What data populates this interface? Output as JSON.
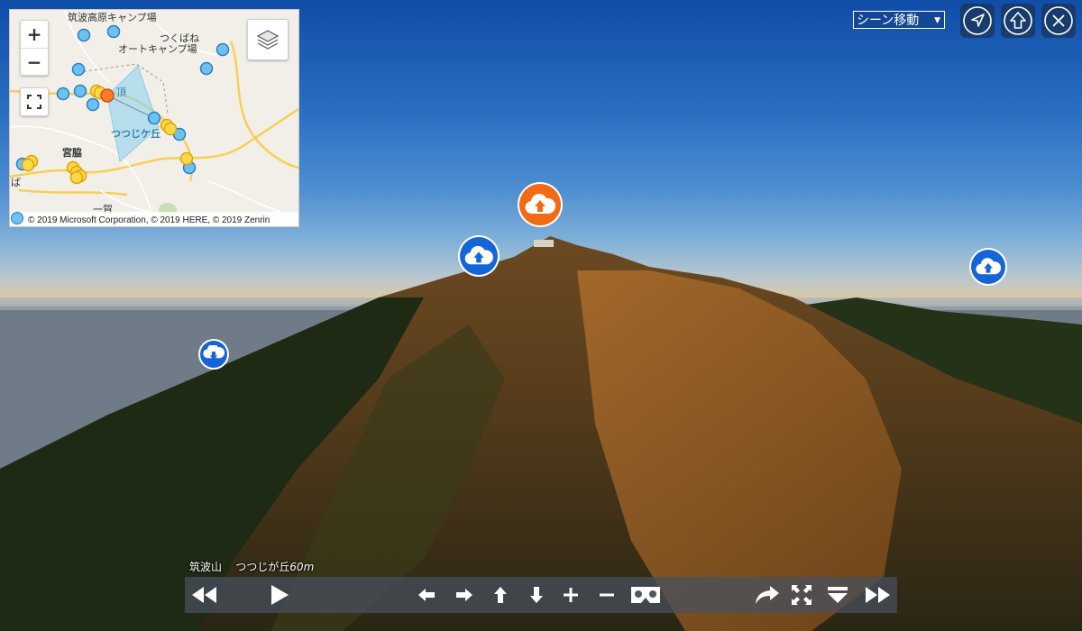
{
  "map": {
    "zoom_in": "+",
    "zoom_out": "−",
    "labels": {
      "camp1": "筑波高原キャンプ場",
      "camp2a": "つくばね",
      "camp2b": "オートキャンプ場",
      "summit": "頂",
      "tsutsuji": "つつじケ丘",
      "miyawaki": "宮脇",
      "edge": "ば",
      "bottom": "一賀"
    },
    "attribution": "© 2019 Microsoft Corporation, © 2019 HERE, © 2019 Zenrin"
  },
  "header": {
    "scene_select": "シーン移動",
    "scene_select_caret": "▼"
  },
  "caption": {
    "place": "筑波山",
    "spot": "つつじが丘",
    "altitude": "60m"
  },
  "colors": {
    "hotspot_blue": "#1565d8",
    "hotspot_orange": "#f26a13",
    "marker_blue": "#6ec0f0",
    "marker_yellow": "#ffd84a",
    "marker_orange": "#ff7a2a"
  },
  "icons": {
    "hotspots": [
      "cloud-up-icon",
      "cloud-up-icon",
      "cloud-up-icon",
      "cloud-down-icon"
    ],
    "top_buttons": [
      "navigation-arrow-icon",
      "up-arrow-icon",
      "close-icon"
    ],
    "controls": [
      "fast-rewind-icon",
      "play-icon",
      "arrow-left-icon",
      "arrow-right-icon",
      "arrow-up-icon",
      "arrow-down-icon",
      "zoom-in-icon",
      "zoom-out-icon",
      "vr-goggles-icon",
      "share-icon",
      "fullscreen-icon",
      "hide-bar-icon",
      "fast-forward-icon"
    ]
  }
}
